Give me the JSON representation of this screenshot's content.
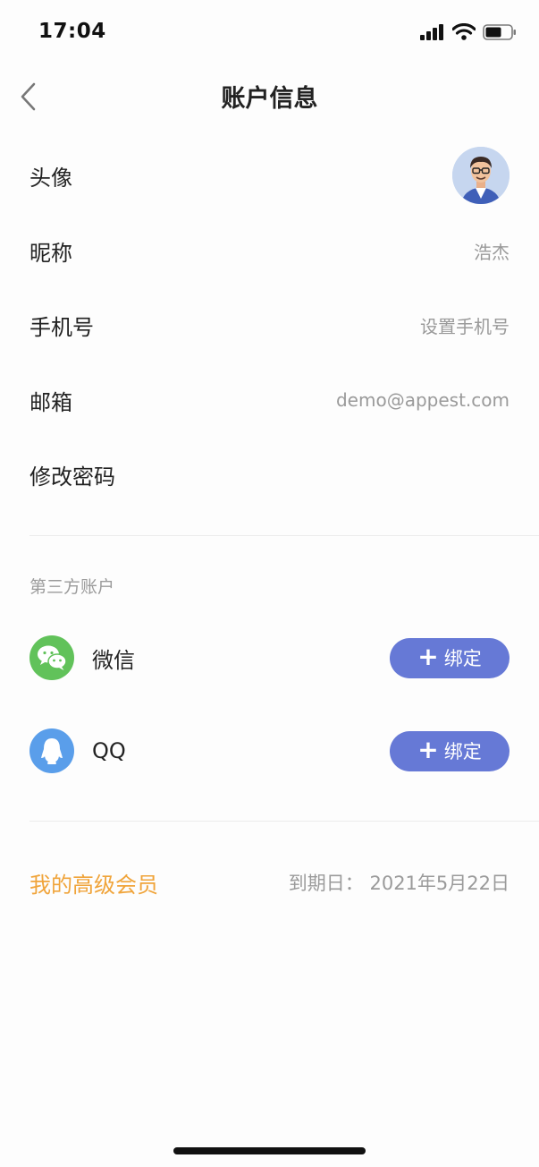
{
  "status_bar": {
    "time": "17:04"
  },
  "nav": {
    "title": "账户信息",
    "back_icon": "chevron-left-icon"
  },
  "profile": {
    "avatar_label": "头像",
    "nickname_label": "昵称",
    "nickname_value": "浩杰",
    "phone_label": "手机号",
    "phone_value": "设置手机号",
    "email_label": "邮箱",
    "email_value": "demo@appest.com",
    "password_label": "修改密码"
  },
  "third_party": {
    "title": "第三方账户",
    "accounts": [
      {
        "name": "微信",
        "icon": "wechat-icon",
        "color": "#61c25a",
        "button": "绑定"
      },
      {
        "name": "QQ",
        "icon": "qq-icon",
        "color": "#5a9eea",
        "button": "绑定"
      }
    ]
  },
  "vip": {
    "label": "我的高级会员",
    "expiry": "到期日：  2021年5月22日"
  },
  "colors": {
    "accent": "#6679d6",
    "vip": "#f0a43a"
  }
}
